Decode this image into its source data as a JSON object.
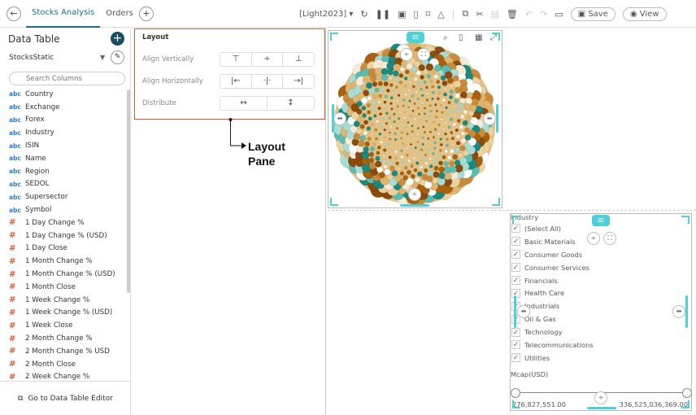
{
  "topbar": {
    "tabs": [
      "Stocks Analysis",
      "Orders"
    ],
    "theme": "[Light2023]",
    "save": "Save",
    "view": "View"
  },
  "left": {
    "title": "Data Table",
    "datasource": "StocksStatic",
    "search_placeholder": "Search Columns",
    "fields": [
      {
        "type": "abc",
        "name": "Country"
      },
      {
        "type": "abc",
        "name": "Exchange"
      },
      {
        "type": "abc",
        "name": "Forex"
      },
      {
        "type": "abc",
        "name": "Industry"
      },
      {
        "type": "abc",
        "name": "ISIN"
      },
      {
        "type": "abc",
        "name": "Name"
      },
      {
        "type": "abc",
        "name": "Region"
      },
      {
        "type": "abc",
        "name": "SEDOL"
      },
      {
        "type": "abc",
        "name": "Supersector"
      },
      {
        "type": "abc",
        "name": "Symbol"
      },
      {
        "type": "#",
        "name": "1 Day Change %"
      },
      {
        "type": "#",
        "name": "1 Day Change % (USD)"
      },
      {
        "type": "#",
        "name": "1 Day Close"
      },
      {
        "type": "#",
        "name": "1 Month Change %"
      },
      {
        "type": "#",
        "name": "1 Month Change % (USD)"
      },
      {
        "type": "#",
        "name": "1 Month Close"
      },
      {
        "type": "#",
        "name": "1 Week Change %"
      },
      {
        "type": "#",
        "name": "1 Week Change % (USD)"
      },
      {
        "type": "#",
        "name": "1 Week Close"
      },
      {
        "type": "#",
        "name": "2 Month Change %"
      },
      {
        "type": "#",
        "name": "2 Month Change % USD"
      },
      {
        "type": "#",
        "name": "2 Month Close"
      },
      {
        "type": "#",
        "name": "2 Week Change %"
      }
    ],
    "footer": "Go to Data Table Editor"
  },
  "layout": {
    "title": "Layout",
    "align_vertically": "Align Vertically",
    "align_horizontally": "Align Horizontally",
    "distribute": "Distribute"
  },
  "callout": {
    "line1": "Layout",
    "line2": "Pane"
  },
  "filter": {
    "title": "Industry",
    "items": [
      "(Select All)",
      "Basic Materials",
      "Consumer Goods",
      "Consumer Services",
      "Financials",
      "Health Care",
      "Industrials",
      "Oil & Gas",
      "Technology",
      "Telecommunications",
      "Utilities"
    ],
    "range_label": "Mcap(USD)",
    "range_min": "276,827,551.00",
    "range_max": "336,525,036,369.00"
  },
  "colors": {
    "accent": "#4dd0d8",
    "brand": "#164e63",
    "highlight": "#e8552f",
    "bubbles": [
      "#8b4a0e",
      "#a8620f",
      "#c98b3a",
      "#dfb66f",
      "#ecd29c",
      "#f5ebd6",
      "#ffffff",
      "#1a8a80",
      "#5bbcb0",
      "#a8ddd6"
    ]
  }
}
